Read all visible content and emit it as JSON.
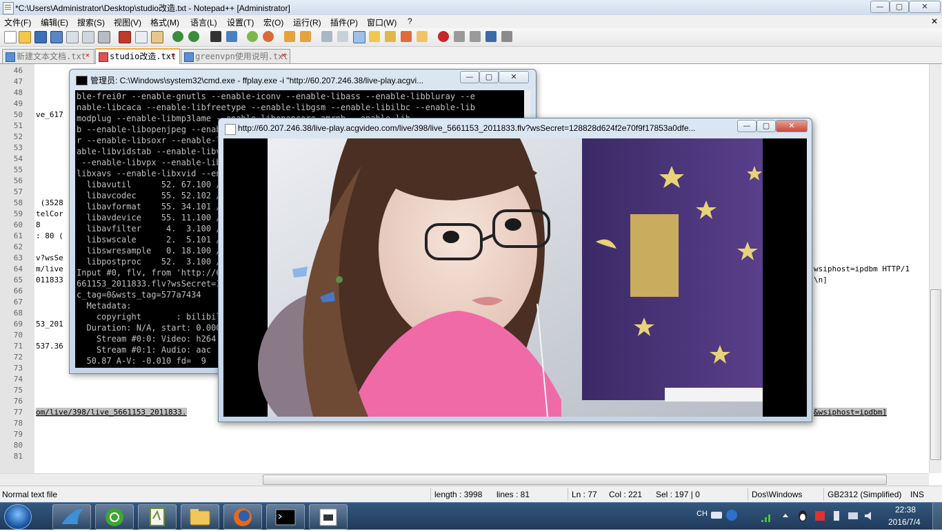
{
  "npp": {
    "title": "*C:\\Users\\Administrator\\Desktop\\studio改造.txt - Notepad++ [Administrator]",
    "window_controls": {
      "minimize": "—",
      "maximize": "▢",
      "close": "✕"
    },
    "menu": [
      "文件(F)",
      "编辑(E)",
      "搜索(S)",
      "视图(V)",
      "格式(M)",
      "语言(L)",
      "设置(T)",
      "宏(O)",
      "运行(R)",
      "插件(P)",
      "窗口(W)",
      "?"
    ],
    "menu_close": "✕",
    "tabs": [
      {
        "label": "新建文本文档.txt",
        "close": "✕"
      },
      {
        "label": "studio改造.txt",
        "close": "✕"
      },
      {
        "label": "greenvpn使用说明.txt",
        "close": "✕"
      }
    ],
    "line_numbers": [
      "46",
      "47",
      "48",
      "49",
      "50",
      "51",
      "52",
      "53",
      "54",
      "55",
      "56",
      "57",
      "58",
      "59",
      "60",
      "61",
      "62",
      "63",
      "64",
      "65",
      "66",
      "67",
      "68",
      "69",
      "70",
      "71",
      "72",
      "73",
      "74",
      "75",
      "76",
      "77",
      "78",
      "79",
      "80",
      "81"
    ],
    "code_left": {
      "l50": "ve_617",
      "l58": " (3528",
      "l59": "telCor",
      "l60": "8",
      "l61": ": 80 (",
      "l63": "v?wsSe",
      "l64": "m/live",
      "l65": "011833",
      "l69": "53_201",
      "l71": "537.36",
      "l77": "om/live/398/live_5661153_2011833."
    },
    "code_right": {
      "l64": "wsiphost=ipdbm HTTP/1",
      "l65": "\\n]",
      "l77": "&wsiphost=ipdbm]"
    },
    "status": {
      "type": "Normal text file",
      "length": "length : 3998",
      "lines": "lines : 81",
      "ln": "Ln : 77",
      "col": "Col : 221",
      "sel": "Sel : 197 | 0",
      "eol": "Dos\\Windows",
      "encoding": "GB2312 (Simplified)",
      "mode": "INS"
    }
  },
  "cmd": {
    "title": "管理员: C:\\Windows\\system32\\cmd.exe - ffplay.exe  -i \"http://60.207.246.38/live-play.acgvi...",
    "lines": [
      "ble-frei0r --enable-gnutls --enable-iconv --enable-libass --enable-libbluray --e",
      "nable-libcaca --enable-libfreetype --enable-libgsm --enable-libilbc --enable-lib",
      "modplug --enable-libmp3lame --enable-libopencore-amrnb --enable-lib",
      "b --enable-libopenjpeg --enable-libopus --enable-librtmp --enable-lib",
      "r --enable-libsoxr --enable-libspeex --enable-libtheora --enable-lib",
      "able-libvidstab --enable-libvo-aacenc --enable-libvo-amrwbenc --en",
      " --enable-libvpx --enable-libwavpack --enable-libwebp --enable-lib",
      "libxavs --enable-libxvid --enable-lzma --enable-decklink --enable-zlib",
      "  libavutil      52. 67.100 / 52. 67.100",
      "  libavcodec     55. 52.102 / 55. 52.102",
      "  libavformat    55. 34.101 / 55. 34.101",
      "  libavdevice    55. 11.100 / 55. 11.100",
      "  libavfilter     4.  3.100 /  4.  3.100",
      "  libswscale      2.  5.101 /  2.  5.101",
      "  libswresample   0. 18.100 /  0. 18.100",
      "  libpostproc    52.  3.100 / 52.  3.100",
      "Input #0, flv, from 'http://60.207.246.38/live-play.acgvideo.com/live/398/live_5",
      "661153_2011833.flv?wsSecret=128828d624f2e70f9f17853a0dfe",
      "c_tag=0&wsts_tag=577a7434",
      "  Metadata:",
      "    copyright       : bilibili",
      "  Duration: N/A, start: 0.000000, bitrate: N/A",
      "    Stream #0:0: Video: h264",
      "    Stream #0:1: Audio: aac",
      "  50.87 A-V: -0.010 fd=  9"
    ]
  },
  "ffplay": {
    "title": "http://60.207.246.38/live-play.acgvideo.com/live/398/live_5661153_2011833.flv?wsSecret=128828d624f2e70f9f17853a0dfe..."
  },
  "taskbar": {
    "tray_lang": "CH",
    "time": "22:38",
    "date": "2016/7/4"
  },
  "colors": {
    "tab_active_accent": "#f4a63a",
    "cmd_background": "#000000",
    "cmd_text": "#c0c0c0",
    "taskbar": "#1f3a5c",
    "close_button": "#c9463d"
  }
}
